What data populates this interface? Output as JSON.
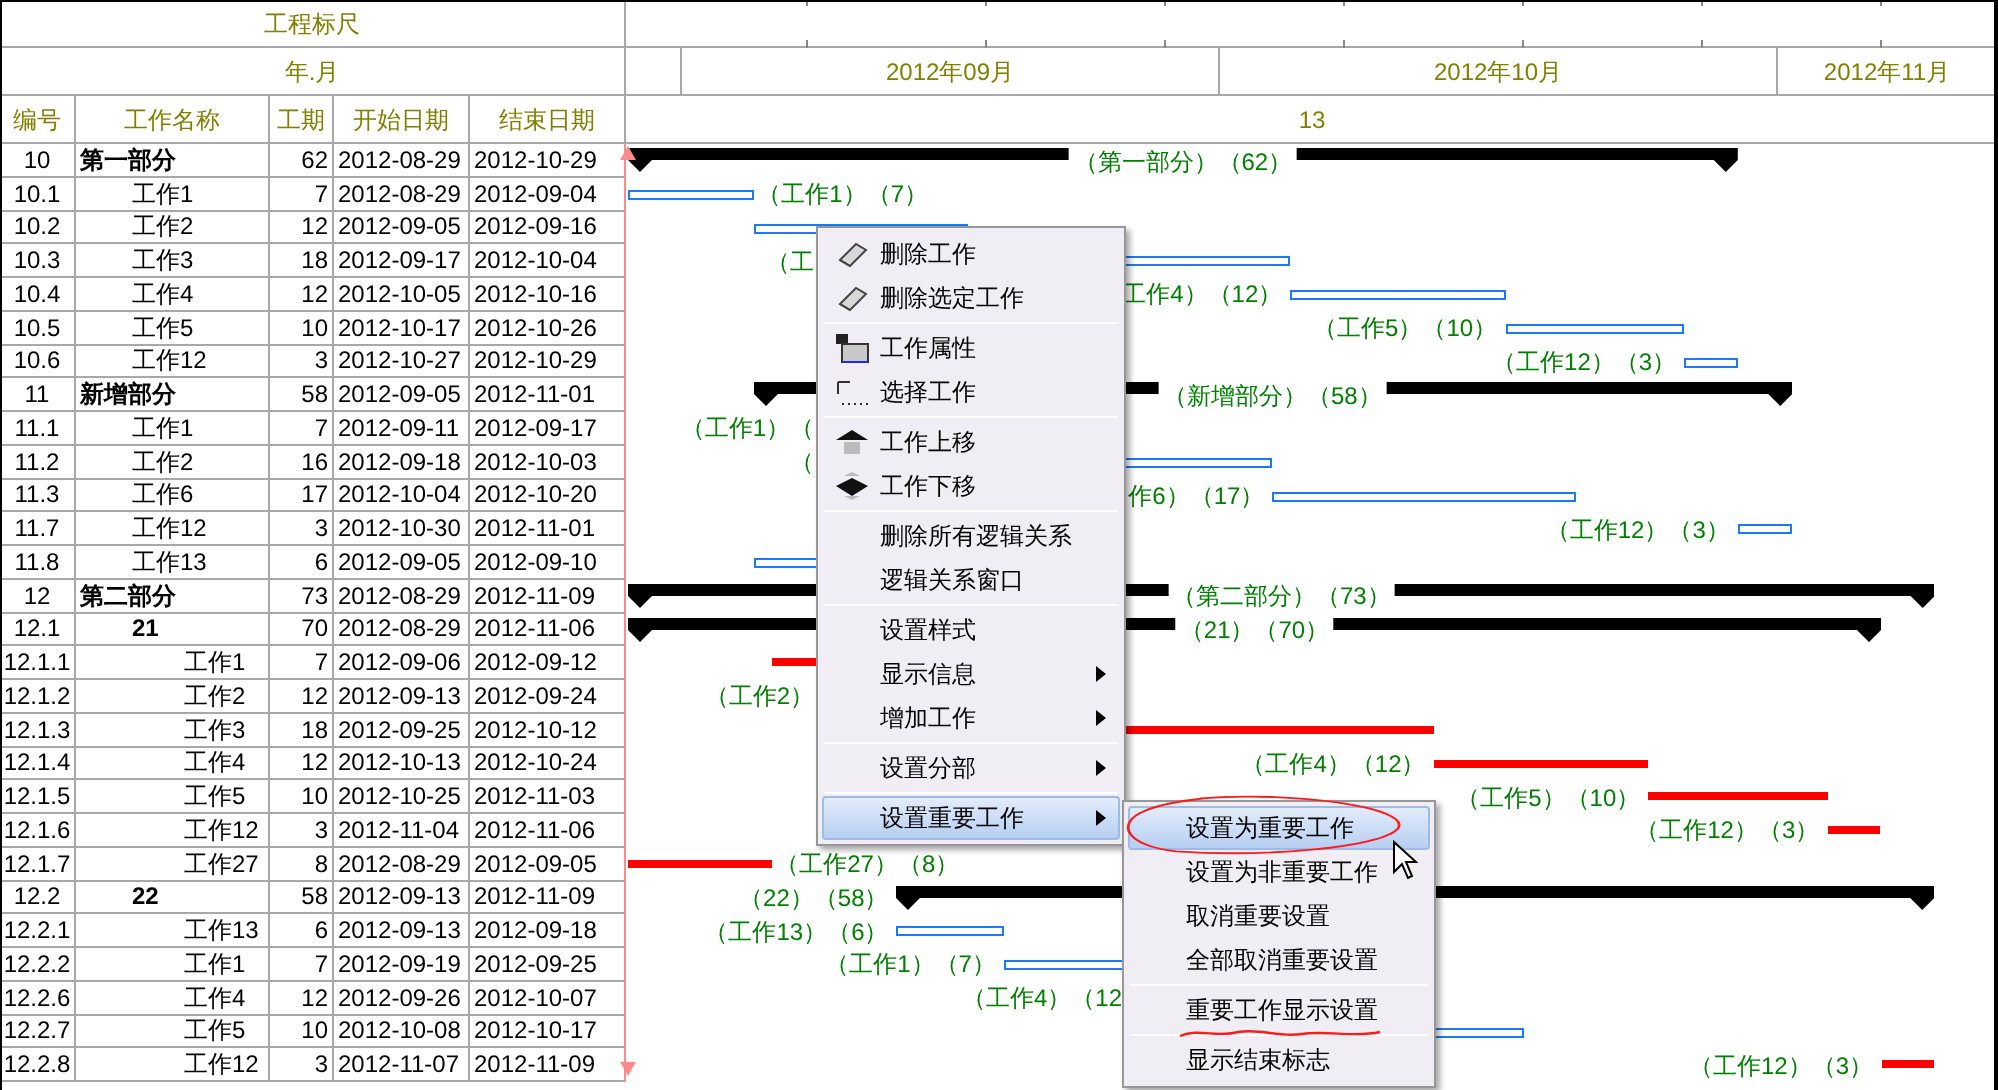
{
  "ruler_header": {
    "title": "工程标尺",
    "subtitle": "年.月"
  },
  "columns": [
    "编号",
    "工作名称",
    "工期",
    "开始日期",
    "结束日期"
  ],
  "timeline": {
    "months": [
      "2012年09月",
      "2012年10月",
      "2012年11月"
    ],
    "scale_label": "13"
  },
  "rows": [
    {
      "id": "10",
      "name": "第一部分",
      "duration": "62",
      "start": "2012-08-29",
      "end": "2012-10-29",
      "bar": {
        "kind": "summary",
        "label": {
          "text": "（第一部分）（62）",
          "kind": "center"
        }
      },
      "children": [
        {
          "id": "10.1",
          "name": "工作1",
          "duration": "7",
          "start": "2012-08-29",
          "end": "2012-09-04",
          "bar": {
            "kind": "normal",
            "label": {
              "text": "（工作1）（7）",
              "kind": "right"
            }
          }
        },
        {
          "id": "10.2",
          "name": "工作2",
          "duration": "12",
          "start": "2012-09-05",
          "end": "2012-09-16",
          "bar": {
            "kind": "normal"
          }
        },
        {
          "id": "10.3",
          "name": "工作3",
          "duration": "18",
          "start": "2012-09-17",
          "end": "2012-10-04",
          "bar": {
            "kind": "normal",
            "label": {
              "text": "（工",
              "kind": "left"
            }
          }
        },
        {
          "id": "10.4",
          "name": "工作4",
          "duration": "12",
          "start": "2012-10-05",
          "end": "2012-10-16",
          "bar": {
            "kind": "normal",
            "label": {
              "text": "工作4）（12）",
              "kind": "left"
            }
          }
        },
        {
          "id": "10.5",
          "name": "工作5",
          "duration": "10",
          "start": "2012-10-17",
          "end": "2012-10-26",
          "bar": {
            "kind": "normal",
            "label": {
              "text": "（工作5）（10）",
              "kind": "left"
            }
          }
        },
        {
          "id": "10.6",
          "name": "工作12",
          "duration": "3",
          "start": "2012-10-27",
          "end": "2012-10-29",
          "bar": {
            "kind": "normal",
            "label": {
              "text": "（工作12）（3）",
              "kind": "left"
            }
          }
        }
      ]
    },
    {
      "id": "11",
      "name": "新增部分",
      "duration": "58",
      "start": "2012-09-05",
      "end": "2012-11-01",
      "bar": {
        "kind": "summary",
        "label": {
          "text": "（新增部分）（58）",
          "kind": "center"
        }
      },
      "children": [
        {
          "id": "11.1",
          "name": "工作1",
          "duration": "7",
          "start": "2012-09-11",
          "end": "2012-09-17",
          "bar": {
            "kind": "normal",
            "label": {
              "text": "（工作1）（",
              "kind": "left"
            }
          }
        },
        {
          "id": "11.2",
          "name": "工作2",
          "duration": "16",
          "start": "2012-09-18",
          "end": "2012-10-03",
          "bar": {
            "kind": "normal",
            "label": {
              "text": "（",
              "kind": "left"
            }
          }
        },
        {
          "id": "11.3",
          "name": "工作6",
          "duration": "17",
          "start": "2012-10-04",
          "end": "2012-10-20",
          "bar": {
            "kind": "normal",
            "label": {
              "text": "作6）（17）",
              "kind": "left"
            }
          }
        },
        {
          "id": "11.7",
          "name": "工作12",
          "duration": "3",
          "start": "2012-10-30",
          "end": "2012-11-01",
          "bar": {
            "kind": "normal",
            "label": {
              "text": "（工作12）（3）",
              "kind": "left"
            }
          }
        },
        {
          "id": "11.8",
          "name": "工作13",
          "duration": "6",
          "start": "2012-09-05",
          "end": "2012-09-10",
          "bar": {
            "kind": "normal"
          }
        }
      ]
    },
    {
      "id": "12",
      "name": "第二部分",
      "duration": "73",
      "start": "2012-08-29",
      "end": "2012-11-09",
      "bar": {
        "kind": "summary",
        "label": {
          "text": "（第二部分）（73）",
          "kind": "center"
        }
      },
      "children": [
        {
          "id": "12.1",
          "name": "21",
          "duration": "70",
          "start": "2012-08-29",
          "end": "2012-11-06",
          "bar": {
            "kind": "summary",
            "label": {
              "text": "（21）（70）",
              "kind": "center"
            }
          },
          "children": [
            {
              "id": "12.1.1",
              "name": "工作1",
              "duration": "7",
              "start": "2012-09-06",
              "end": "2012-09-12",
              "bar": {
                "kind": "critical"
              }
            },
            {
              "id": "12.1.2",
              "name": "工作2",
              "duration": "12",
              "start": "2012-09-13",
              "end": "2012-09-24",
              "bar": {
                "kind": "critical",
                "label": {
                  "text": "（工作2）",
                  "kind": "left"
                }
              }
            },
            {
              "id": "12.1.3",
              "name": "工作3",
              "duration": "18",
              "start": "2012-09-25",
              "end": "2012-10-12",
              "bar": {
                "kind": "critical"
              }
            },
            {
              "id": "12.1.4",
              "name": "工作4",
              "duration": "12",
              "start": "2012-10-13",
              "end": "2012-10-24",
              "bar": {
                "kind": "critical",
                "label": {
                  "text": "（工作4）（12）",
                  "kind": "left"
                }
              }
            },
            {
              "id": "12.1.5",
              "name": "工作5",
              "duration": "10",
              "start": "2012-10-25",
              "end": "2012-11-03",
              "bar": {
                "kind": "critical",
                "label": {
                  "text": "（工作5）（10）",
                  "kind": "left"
                }
              }
            },
            {
              "id": "12.1.6",
              "name": "工作12",
              "duration": "3",
              "start": "2012-11-04",
              "end": "2012-11-06",
              "bar": {
                "kind": "critical",
                "label": {
                  "text": "（工作12）（3）",
                  "kind": "left"
                }
              }
            },
            {
              "id": "12.1.7",
              "name": "工作27",
              "duration": "8",
              "start": "2012-08-29",
              "end": "2012-09-05",
              "bar": {
                "kind": "critical",
                "label": {
                  "text": "（工作27）（8）",
                  "kind": "right"
                }
              }
            }
          ]
        },
        {
          "id": "12.2",
          "name": "22",
          "duration": "58",
          "start": "2012-09-13",
          "end": "2012-11-09",
          "bar": {
            "kind": "summary",
            "label": {
              "text": "（22）（58）",
              "kind": "left"
            }
          },
          "children": [
            {
              "id": "12.2.1",
              "name": "工作13",
              "duration": "6",
              "start": "2012-09-13",
              "end": "2012-09-18",
              "bar": {
                "kind": "normal",
                "label": {
                  "text": "（工作13）（6）",
                  "kind": "left"
                }
              }
            },
            {
              "id": "12.2.2",
              "name": "工作1",
              "duration": "7",
              "start": "2012-09-19",
              "end": "2012-09-25",
              "bar": {
                "kind": "normal",
                "label": {
                  "text": "（工作1）（7）",
                  "kind": "left"
                }
              }
            },
            {
              "id": "12.2.6",
              "name": "工作4",
              "duration": "12",
              "start": "2012-09-26",
              "end": "2012-10-07",
              "bar": {
                "kind": "normal",
                "label": {
                  "text": "（工作4）（12",
                  "kind": "left"
                }
              }
            },
            {
              "id": "12.2.7",
              "name": "工作5",
              "duration": "10",
              "start": "2012-10-08",
              "end": "2012-10-17",
              "bar": {
                "kind": "normal"
              }
            },
            {
              "id": "12.2.8",
              "name": "工作12",
              "duration": "3",
              "start": "2012-11-07",
              "end": "2012-11-09",
              "bar": {
                "kind": "critical",
                "label": {
                  "text": "（工作12）（3）",
                  "kind": "left"
                }
              }
            }
          ]
        }
      ]
    }
  ],
  "context_menu": {
    "groups": [
      [
        {
          "label": "删除工作",
          "kind": "eraser",
          "submenu": false,
          "selected": false
        },
        {
          "label": "删除选定工作",
          "kind": "eraser",
          "submenu": false,
          "selected": false
        }
      ],
      [
        {
          "label": "工作属性",
          "kind": "properties",
          "submenu": false,
          "selected": false
        },
        {
          "label": "选择工作",
          "kind": "select",
          "submenu": false,
          "selected": false
        }
      ],
      [
        {
          "label": "工作上移",
          "kind": "up",
          "submenu": false,
          "selected": false
        },
        {
          "label": "工作下移",
          "kind": "down",
          "submenu": false,
          "selected": false
        }
      ],
      [
        {
          "label": "删除所有逻辑关系",
          "submenu": false,
          "selected": false
        },
        {
          "label": "逻辑关系窗口",
          "submenu": false,
          "selected": false
        }
      ],
      [
        {
          "label": "设置样式",
          "submenu": false,
          "selected": false
        },
        {
          "label": "显示信息",
          "submenu": true,
          "selected": false
        },
        {
          "label": "增加工作",
          "submenu": true,
          "selected": false
        }
      ],
      [
        {
          "label": "设置分部",
          "submenu": true,
          "selected": false
        }
      ],
      [
        {
          "label": "设置重要工作",
          "submenu": true,
          "selected": true
        }
      ]
    ]
  },
  "submenu": {
    "groups": [
      [
        {
          "label": "设置为重要工作",
          "submenu": false,
          "selected": true
        },
        {
          "label": "设置为非重要工作",
          "submenu": false,
          "selected": false
        },
        {
          "label": "取消重要设置",
          "submenu": false,
          "selected": false
        },
        {
          "label": "全部取消重要设置",
          "submenu": false,
          "selected": false
        }
      ],
      [
        {
          "label": "重要工作显示设置",
          "submenu": false,
          "selected": false
        }
      ],
      [
        {
          "label": "显示结束标志",
          "submenu": false,
          "selected": false
        }
      ]
    ]
  }
}
